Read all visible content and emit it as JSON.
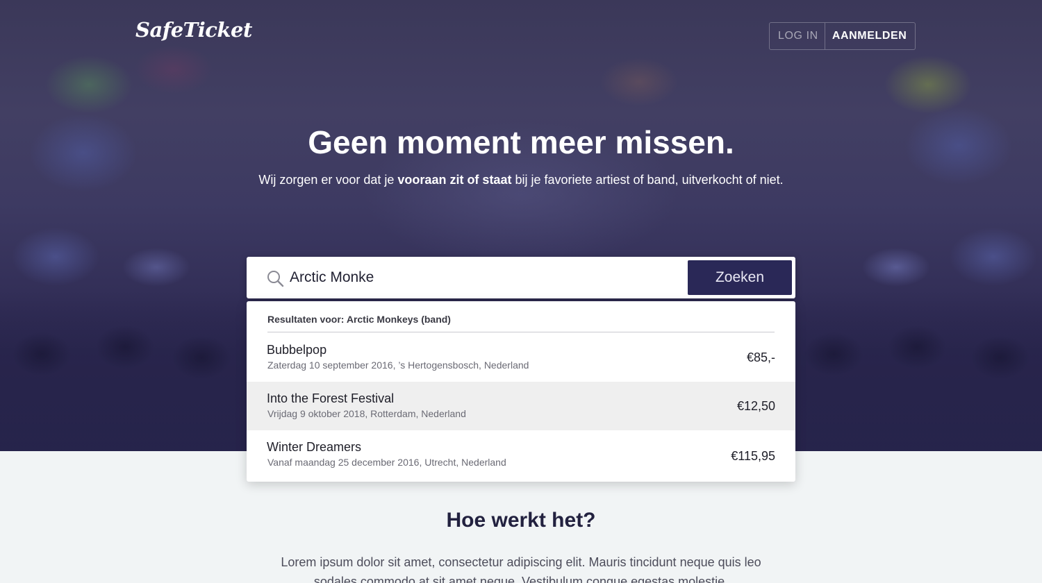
{
  "brand": {
    "logo_text": "SafeTicket"
  },
  "auth": {
    "login_label": "LOG IN",
    "signup_label": "AANMELDEN"
  },
  "hero": {
    "headline": "Geen moment meer missen.",
    "subline_before": "Wij zorgen er voor dat je ",
    "subline_bold": "vooraan zit of staat",
    "subline_after": " bij je favoriete artiest of band, uitverkocht of niet."
  },
  "search": {
    "value": "Arctic Monke",
    "button_label": "Zoeken"
  },
  "results": {
    "header": "Resultaten voor: Arctic Monkeys (band)",
    "items": [
      {
        "name": "Bubbelpop",
        "meta": "Zaterdag 10 september 2016, ’s Hertogensbosch, Nederland",
        "price": "€85,-"
      },
      {
        "name": "Into the Forest Festival",
        "meta": "Vrijdag 9 oktober 2018, Rotterdam, Nederland",
        "price": "€12,50"
      },
      {
        "name": "Winter Dreamers",
        "meta": "Vanaf maandag 25 december 2016, Utrecht, Nederland",
        "price": "€115,95"
      }
    ]
  },
  "how": {
    "title": "Hoe werkt het?",
    "text": "Lorem ipsum dolor sit amet, consectetur adipiscing elit. Mauris tincidunt neque quis leo sodales commodo at sit amet neque. Vestibulum congue egestas molestie."
  },
  "colors": {
    "accent": "#2a2857",
    "hero_bg": "#302c55",
    "page_bg": "#f1f4f5"
  },
  "icons": {
    "search": "search-icon"
  }
}
